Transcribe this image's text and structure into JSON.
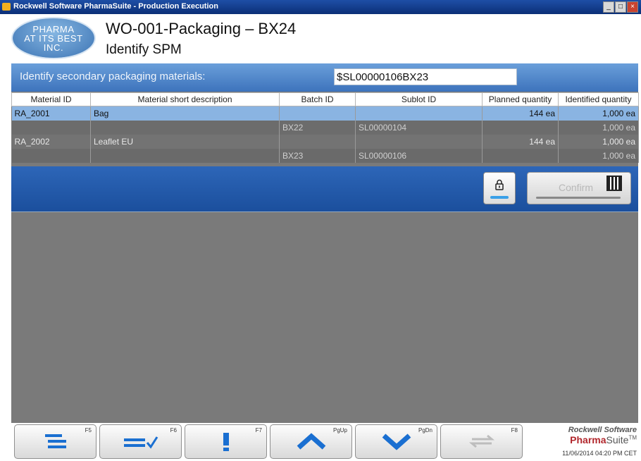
{
  "window": {
    "title": "Rockwell Software PharmaSuite - Production Execution",
    "minimize_glyph": "_",
    "restore_glyph": "□",
    "close_glyph": "×"
  },
  "header": {
    "logo_line1": "PHARMA",
    "logo_line2": "AT ITS BEST",
    "logo_line3": "INC.",
    "title": "WO-001-Packaging  –  BX24",
    "subtitle": "Identify SPM"
  },
  "identify": {
    "label": "Identify secondary packaging materials:",
    "input_value": "$SL00000106BX23"
  },
  "table": {
    "headers": [
      "Material ID",
      "Material short description",
      "Batch ID",
      "Sublot ID",
      "Planned quantity",
      "Identified quantity"
    ],
    "rows": [
      [
        "RA_2001",
        "Bag",
        "",
        "",
        "144 ea",
        "1,000 ea"
      ],
      [
        "",
        "",
        "BX22",
        "SL00000104",
        "",
        "1,000 ea"
      ],
      [
        "RA_2002",
        "Leaflet EU",
        "",
        "",
        "144 ea",
        "1,000 ea"
      ],
      [
        "",
        "",
        "BX23",
        "SL00000106",
        "",
        "1,000 ea"
      ]
    ]
  },
  "actions": {
    "lock_icon": "padlock-icon",
    "confirm_label": "Confirm",
    "confirm_icon": "datamatrix-icon"
  },
  "fkeys": [
    {
      "key": "F5",
      "icon": "menu-lines-icon"
    },
    {
      "key": "F6",
      "icon": "list-check-icon"
    },
    {
      "key": "F7",
      "icon": "exclamation-icon"
    },
    {
      "key": "PgUp",
      "icon": "chevron-up-icon"
    },
    {
      "key": "PgDn",
      "icon": "chevron-down-icon"
    },
    {
      "key": "F8",
      "icon": "swap-arrows-icon"
    }
  ],
  "brand": {
    "company": "Rockwell Software",
    "product_part1": "Pharma",
    "product_part2": "Suite",
    "trademark": "TM",
    "timestamp": "11/06/2014 04:20 PM CET"
  },
  "colors": {
    "accent_blue": "#3d73bc",
    "selected_row": "#8ab4e2",
    "button_icon": "#1a6fd1"
  }
}
